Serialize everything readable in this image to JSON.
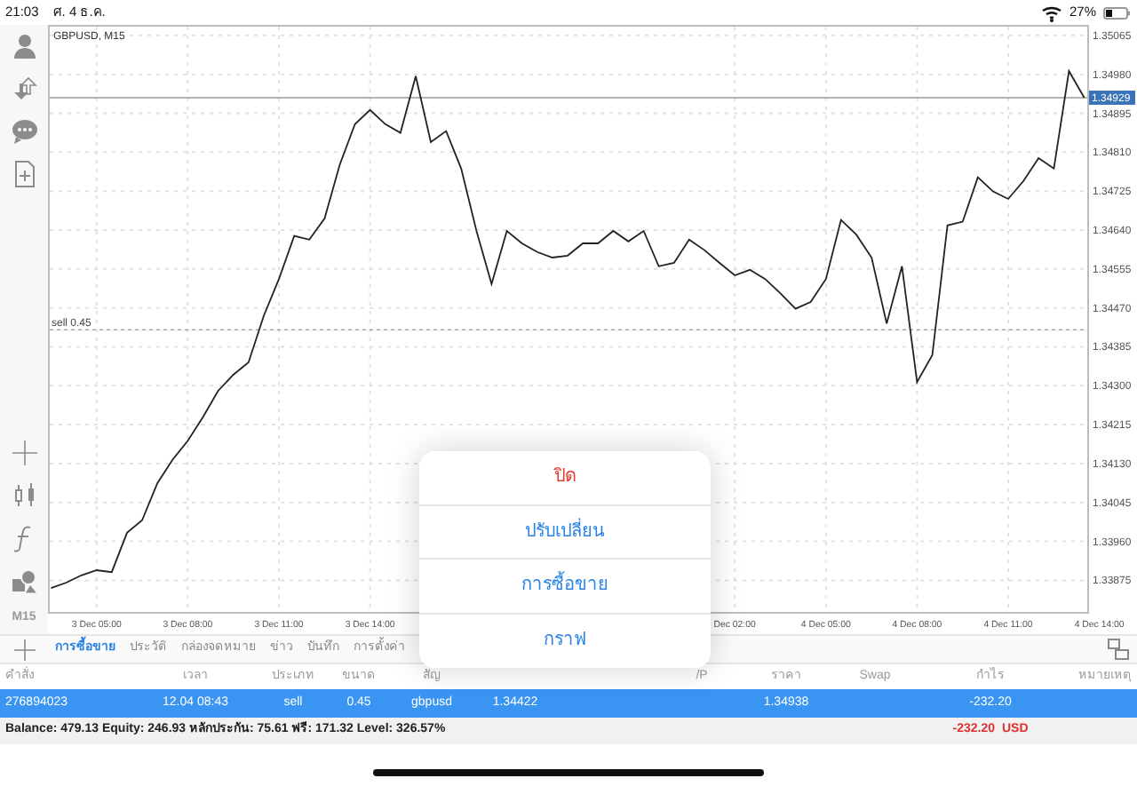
{
  "status_bar": {
    "time": "21:03",
    "date": "ศ. 4 ธ.ค.",
    "battery": "27%"
  },
  "sidebar": {
    "timeframe": "M15"
  },
  "chart": {
    "title": "GBPUSD, M15",
    "chart_data": {
      "type": "line",
      "grid": true,
      "ylim": [
        1.33804,
        1.35088
      ],
      "ref_lines": [
        {
          "axis": "y",
          "value": 1.34929,
          "label": "1.34929"
        },
        {
          "axis": "y",
          "value": 1.34422,
          "label": "sell 0.45"
        }
      ],
      "categories": [
        null,
        null,
        null,
        "3 Dec 05:00",
        null,
        null,
        null,
        null,
        null,
        "3 Dec 08:00",
        null,
        null,
        null,
        null,
        null,
        "3 Dec 11:00",
        null,
        null,
        null,
        null,
        null,
        "3 Dec 14:00",
        null,
        null,
        null,
        null,
        null,
        null,
        null,
        null,
        null,
        null,
        null,
        null,
        null,
        null,
        null,
        null,
        null,
        null,
        null,
        null,
        null,
        null,
        null,
        "Dec 02:00",
        null,
        null,
        null,
        null,
        null,
        "4 Dec 05:00",
        null,
        null,
        null,
        null,
        null,
        "4 Dec 08:00",
        null,
        null,
        null,
        null,
        null,
        "4 Dec 11:00",
        null,
        null,
        null,
        null,
        null,
        "4 Dec 14:00"
      ],
      "series": [
        {
          "color": "#222222",
          "values": [
            1.33858,
            1.3387,
            1.33886,
            1.33897,
            1.33893,
            1.33979,
            1.34006,
            1.34087,
            1.34138,
            1.3418,
            1.34231,
            1.34289,
            1.34324,
            1.34351,
            1.34452,
            1.34533,
            1.34627,
            1.34619,
            1.34665,
            1.34782,
            1.34871,
            1.34902,
            1.34871,
            1.34852,
            1.34976,
            1.34832,
            1.34856,
            1.34774,
            1.34638,
            1.34522,
            1.34638,
            1.34611,
            1.34592,
            1.3458,
            1.34584,
            1.34611,
            1.34611,
            1.34638,
            1.34615,
            1.34638,
            1.34561,
            1.34568,
            1.34619,
            1.34596,
            1.34568,
            1.34541,
            1.34553,
            1.34533,
            1.34502,
            1.34468,
            1.34483,
            1.34533,
            1.34662,
            1.3463,
            1.3458,
            1.34436,
            1.34561,
            1.34308,
            1.34367,
            1.3465,
            1.34658,
            1.34755,
            1.34724,
            1.34708,
            1.34747,
            1.34797,
            1.34774,
            1.34987,
            1.34929,
            null
          ]
        }
      ],
      "yticks": [
        {
          "value": 1.35065,
          "label": "1.35065"
        },
        {
          "value": 1.3498,
          "label": "1.34980"
        },
        {
          "value": 1.34895,
          "label": "1.34895"
        },
        {
          "value": 1.3481,
          "label": "1.34810"
        },
        {
          "value": 1.34725,
          "label": "1.34725"
        },
        {
          "value": 1.3464,
          "label": "1.34640"
        },
        {
          "value": 1.34555,
          "label": "1.34555"
        },
        {
          "value": 1.3447,
          "label": "1.34470"
        },
        {
          "value": 1.34385,
          "label": "1.34385"
        },
        {
          "value": 1.343,
          "label": "1.34300"
        },
        {
          "value": 1.34215,
          "label": "1.34215"
        },
        {
          "value": 1.3413,
          "label": "1.34130"
        },
        {
          "value": 1.34045,
          "label": "1.34045"
        },
        {
          "value": 1.3396,
          "label": "1.33960"
        },
        {
          "value": 1.33875,
          "label": "1.33875"
        }
      ]
    }
  },
  "tabs": [
    {
      "label": "การซื้อขาย",
      "selected": true
    },
    {
      "label": "ประวัติ",
      "selected": false
    },
    {
      "label": "กล่องจดหมาย",
      "selected": false
    },
    {
      "label": "ข่าว",
      "selected": false
    },
    {
      "label": "บันทึก",
      "selected": false
    },
    {
      "label": "การตั้งค่า",
      "selected": false
    }
  ],
  "table": {
    "columns": [
      "คำสั่ง",
      "เวลา",
      "ประเภท",
      "ขนาด",
      "สัญ",
      null,
      null,
      "/P",
      "ราคา",
      "Swap",
      "กำไร",
      "หมายเหตุ"
    ],
    "rows": [
      {
        "selected": true,
        "cells": [
          "276894023",
          "12.04 08:43",
          "sell",
          "0.45",
          "gbpusd",
          "1.34422",
          null,
          null,
          "1.34938",
          null,
          "-232.20",
          null
        ]
      }
    ],
    "summary": {
      "text": "Balance: 479.13 Equity: 246.93 หลักประกัน: 75.61 ฟรี: 171.32 Level: 326.57%",
      "profit": "-232.20",
      "currency": "USD"
    }
  },
  "action_sheet": {
    "items": [
      {
        "label": "ปิด",
        "kind": "destructive"
      },
      {
        "label": "ปรับเปลี่ยน",
        "kind": "default"
      },
      {
        "label": "การซื้อขาย",
        "kind": "default"
      },
      {
        "label": "กราฟ",
        "kind": "default"
      }
    ]
  }
}
